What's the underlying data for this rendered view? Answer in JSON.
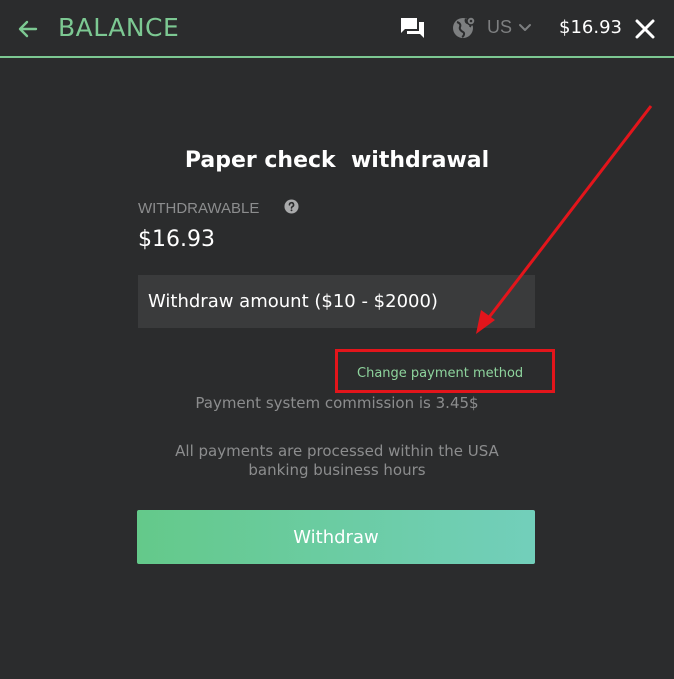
{
  "header": {
    "title": "BALANCE",
    "region": "US",
    "balance": "$16.93",
    "icons": [
      "arrow-left-icon",
      "chat-icon",
      "globe-icon",
      "chevron-down-icon",
      "close-icon"
    ]
  },
  "main": {
    "heading": "Paper check  withdrawal",
    "withdrawable_label": "WITHDRAWABLE",
    "withdrawable_amount": "$16.93",
    "amount_placeholder": "Withdraw amount ($10 - $2000)",
    "change_payment_method": "Change payment method",
    "commission_text": "Payment system commission is 3.45$",
    "notice_text": "All payments are processed within the USA banking business hours",
    "withdraw_button": "Withdraw"
  },
  "colors": {
    "accent": "#7cc892",
    "background": "#2b2c2d",
    "annotation": "#e3151b"
  }
}
